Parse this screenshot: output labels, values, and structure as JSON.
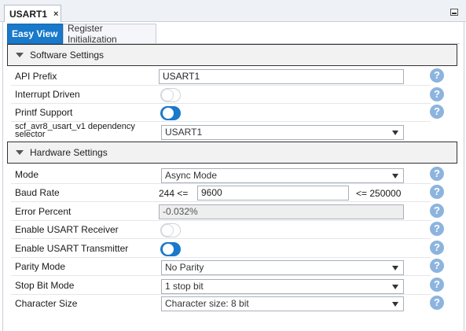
{
  "doc_tab": {
    "label": "USART1",
    "close": "×"
  },
  "subtabs": {
    "easy_view": "Easy View",
    "register_init": "Register Initialization"
  },
  "software": {
    "title": "Software Settings",
    "api_prefix": {
      "label": "API Prefix",
      "value": "USART1"
    },
    "interrupt_driven": {
      "label": "Interrupt Driven",
      "state": "off"
    },
    "printf_support": {
      "label": "Printf Support",
      "state": "on"
    },
    "dependency": {
      "label": "scf_avr8_usart_v1 dependency selector",
      "value": "USART1"
    }
  },
  "hardware": {
    "title": "Hardware Settings",
    "mode": {
      "label": "Mode",
      "value": "Async Mode"
    },
    "baud_rate": {
      "label": "Baud Rate",
      "min_text": "244 <=",
      "value": "9600",
      "max_text": "<= 250000"
    },
    "error_percent": {
      "label": "Error Percent",
      "value": "-0.032%"
    },
    "enable_receiver": {
      "label": "Enable USART Receiver",
      "state": "off"
    },
    "enable_transmitter": {
      "label": "Enable USART Transmitter",
      "state": "on"
    },
    "parity_mode": {
      "label": "Parity Mode",
      "value": "No Parity"
    },
    "stop_bit_mode": {
      "label": "Stop Bit Mode",
      "value": "1 stop bit"
    },
    "character_size": {
      "label": "Character Size",
      "value": "Character size: 8 bit"
    }
  },
  "help_glyph": "?",
  "colors": {
    "accent": "#1979ca",
    "help": "#8cb4de"
  }
}
